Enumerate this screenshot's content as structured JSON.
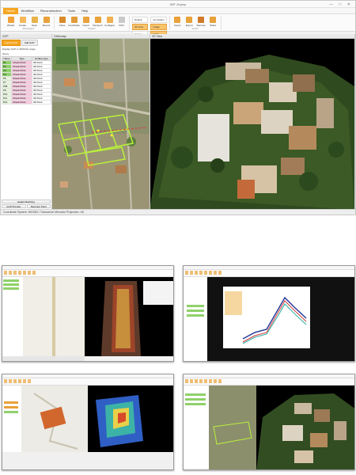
{
  "app": {
    "title": "3DF Zephyr",
    "window_buttons": "— □ ✕"
  },
  "menu": [
    "Home",
    "Workflow",
    "Reconstruction",
    "Tools",
    "Help"
  ],
  "ribbon": {
    "groups": [
      {
        "name": "Workspace",
        "buttons": [
          {
            "label": "Wizard",
            "icon": "wizard-icon",
            "color": "#f2a33a"
          },
          {
            "label": "Create",
            "icon": "new-project-icon",
            "color": "#f6b85a"
          },
          {
            "label": "Open",
            "icon": "open-folder-icon",
            "color": "#e8b34b"
          },
          {
            "label": "Recent",
            "icon": "recent-icon",
            "color": "#e9a23b"
          }
        ]
      },
      {
        "name": "Project",
        "buttons": [
          {
            "label": "Close",
            "icon": "close-project-icon",
            "color": "#d98b2b"
          },
          {
            "label": "Coordinate",
            "icon": "coordinate-icon",
            "color": "#e19c3a"
          },
          {
            "label": "Import",
            "icon": "import-icon",
            "color": "#e9a23b"
          },
          {
            "label": "Reimport",
            "icon": "reimport-icon",
            "color": "#e9a23b"
          },
          {
            "label": "Configure",
            "icon": "configure-icon",
            "color": "#f0b050"
          },
          {
            "label": "GPU",
            "icon": "gpu-icon",
            "color": "#c9c9c9"
          }
        ]
      }
    ],
    "window_group": {
      "name": "Window",
      "toggles": [
        {
          "label": "Default",
          "on": false
        },
        {
          "label": "Annotation",
          "on": false
        },
        {
          "label": "3D View",
          "on": true
        },
        {
          "label": "Image",
          "on": true
        },
        {
          "label": "Images",
          "on": false
        },
        {
          "label": "GCP",
          "on": true
        }
      ]
    },
    "vector_group": {
      "name": "Vector",
      "buttons": [
        {
          "label": "Import",
          "icon": "import-vector-icon",
          "color": "#e9a23b"
        },
        {
          "label": "Export",
          "icon": "export-vector-icon",
          "color": "#e9a23b"
        },
        {
          "label": "Remove",
          "icon": "remove-icon",
          "color": "#d07a2a"
        },
        {
          "label": "Share",
          "icon": "share-icon",
          "color": "#e9a23b"
        }
      ]
    }
  },
  "panels": {
    "gcp_title": "GCP",
    "ortho_title": "Orthomap",
    "view3d_title": "3D View"
  },
  "gcp": {
    "tabs": [
      "Import GCP",
      "Add GCP"
    ],
    "subtitle": "Display GCP in 3D/Ortho range",
    "filter_label": "Query",
    "columns": [
      "Name",
      "Type",
      "Surface type"
    ],
    "rows": [
      {
        "name": "P1",
        "type": "Check Point",
        "surface": "3D Point"
      },
      {
        "name": "P2",
        "type": "Check Point",
        "surface": "3D Point"
      },
      {
        "name": "P3",
        "type": "Check Point",
        "surface": "3D Point"
      },
      {
        "name": "P4",
        "type": "Check Point",
        "surface": "3D Point"
      },
      {
        "name": "P5",
        "type": "Check Point",
        "surface": "3D Point"
      },
      {
        "name": "P7",
        "type": "Check Point",
        "surface": "3D Point"
      },
      {
        "name": "P08",
        "type": "Check Point",
        "surface": "3D Point"
      },
      {
        "name": "P9",
        "type": "Check Point",
        "surface": "3D Point"
      },
      {
        "name": "P10",
        "type": "Check Point",
        "surface": "3D Point"
      },
      {
        "name": "P11",
        "type": "Check Point",
        "surface": "3D Point"
      },
      {
        "name": "P12",
        "type": "Check Point",
        "surface": "3D Point"
      }
    ],
    "footer_buttons": [
      "Height Matching",
      "GCP Preview",
      "Recenter Point Cloud"
    ]
  },
  "status": "Coordinate System: WGS84 / Transverse Mercator Projection, UK",
  "colors": {
    "accent": "#f5a623",
    "gcp_green": "#8fd16a",
    "grid_green": "#b9f13c"
  }
}
